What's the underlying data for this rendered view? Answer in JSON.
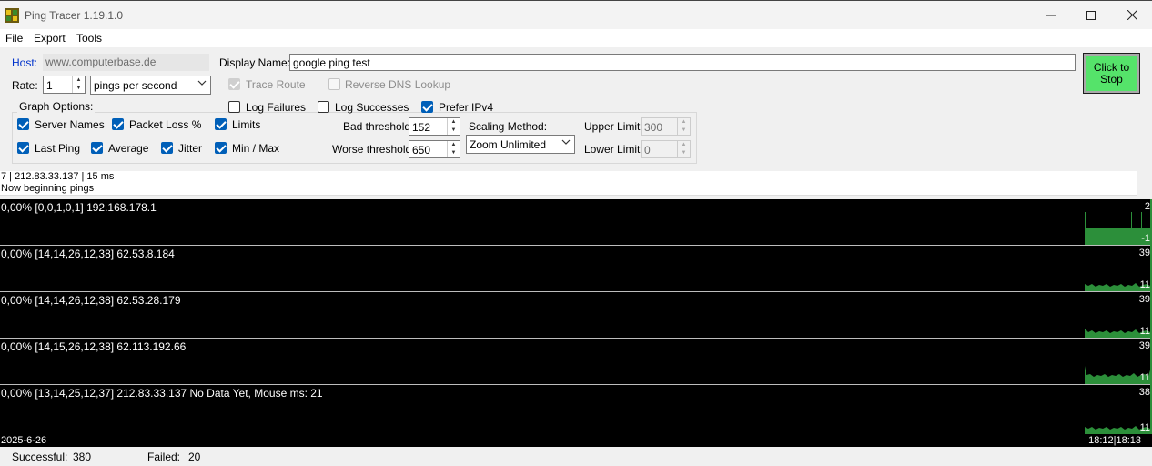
{
  "window": {
    "title": "Ping Tracer 1.19.1.0",
    "minimize_icon": "minimize-icon",
    "maximize_icon": "maximize-icon",
    "close_icon": "close-icon"
  },
  "menu": [
    "File",
    "Export",
    "Tools"
  ],
  "host": {
    "label": "Host:",
    "value": "www.computerbase.de",
    "label_color": "#0033cc"
  },
  "display_name": {
    "label": "Display Name:",
    "value": "google ping test"
  },
  "rate": {
    "label": "Rate:",
    "value": "1",
    "unit": "pings per second"
  },
  "trace_route": {
    "label": "Trace Route",
    "checked": true,
    "enabled": false
  },
  "reverse_dns": {
    "label": "Reverse DNS Lookup",
    "checked": false,
    "enabled": false
  },
  "stop_button": {
    "label": "Click to Stop",
    "color": "#55e36a"
  },
  "graph_options": {
    "legend": "Graph Options:",
    "server_names": "Server Names",
    "packet_loss": "Packet Loss %",
    "limits": "Limits",
    "last_ping": "Last Ping",
    "average": "Average",
    "jitter": "Jitter",
    "min_max": "Min / Max"
  },
  "log_failures": {
    "label": "Log Failures",
    "checked": false
  },
  "log_successes": {
    "label": "Log Successes",
    "checked": false
  },
  "prefer_ipv4": {
    "label": "Prefer IPv4",
    "checked": true
  },
  "bad_threshold": {
    "label": "Bad threshold:",
    "value": "152"
  },
  "worse_threshold": {
    "label": "Worse threshold:",
    "value": "650"
  },
  "scaling": {
    "label": "Scaling Method:",
    "value": "Zoom Unlimited"
  },
  "upper_limit": {
    "label": "Upper Limit:",
    "value": "300"
  },
  "lower_limit": {
    "label": "Lower Limit:",
    "value": "0"
  },
  "log_lines": [
    "7 | 212.83.33.137 | 15 ms",
    "Now beginning pings"
  ],
  "graphs": [
    {
      "label": "0,00% [0,0,1,0,1] 192.168.178.1",
      "max": "2",
      "min": "-1"
    },
    {
      "label": "0,00% [14,14,26,12,38] 62.53.8.184",
      "max": "39",
      "min": "11"
    },
    {
      "label": "0,00% [14,14,26,12,38] 62.53.28.179",
      "max": "39",
      "min": "11"
    },
    {
      "label": "0,00% [14,15,26,12,38] 62.113.192.66",
      "max": "39",
      "min": "11"
    },
    {
      "label": "0,00% [13,14,25,12,37] 212.83.33.137 No Data Yet, Mouse ms: 21",
      "max": "38",
      "min": "11"
    }
  ],
  "footer": {
    "date": "2025-6-26",
    "times": "18:12|18:13"
  },
  "status": {
    "successful_label": "Successful:",
    "successful_value": "380",
    "failed_label": "Failed:",
    "failed_value": "20"
  },
  "colors": {
    "graph_bar": "#2c8f3a",
    "graph_bg": "#000000",
    "accent": "#005fb8"
  }
}
